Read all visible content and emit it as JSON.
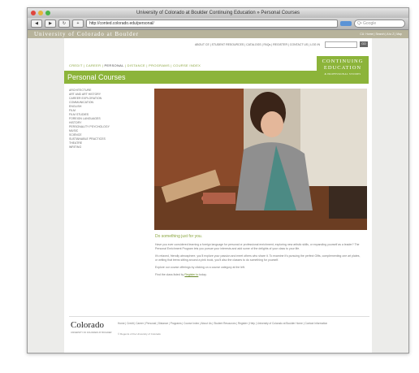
{
  "window": {
    "title": "University of Colorado at Boulder Continuing Education » Personal Courses"
  },
  "toolbar": {
    "back": "◀",
    "forward": "▶",
    "refresh": "↻",
    "add": "+",
    "url": "http://conted.colorado.edu/personal/",
    "search_placeholder": "Q• Google"
  },
  "cu_header": {
    "brand": "University of Colorado at Boulder",
    "links": "CU: Home | Search | A to Z | Map"
  },
  "top_nav": "ABOUT CE | STUDENT RESOURCES | CATALOGS | FAQs | REGISTER | CONTACT US | LOG IN",
  "site_search": {
    "button": "GO"
  },
  "section_nav": {
    "items": [
      "CREDIT",
      "CAREER",
      "PERSONAL",
      "DISTANCE",
      "PROGRAMS",
      "COURSE INDEX"
    ],
    "active": "PERSONAL"
  },
  "logo": {
    "line1": "CONTINUING",
    "line2": "EDUCATION",
    "line3": "& PROFESSIONAL STUDIES"
  },
  "page_title": "Personal Courses",
  "sidebar": {
    "items": [
      "ARCHITECTURE",
      "ART AND ART HISTORY",
      "CAREER EXPLORATION",
      "COMMUNICATION",
      "ENGLISH",
      "FILM",
      "FILM STUDIES",
      "FOREIGN LANGUAGES",
      "HISTORY",
      "PERSONALITY PSYCHOLOGY",
      "MUSIC",
      "SCIENCE",
      "SUSTAINABLE PRACTICES",
      "THEATRE",
      "WRITING"
    ]
  },
  "content": {
    "tagline": "Do something just for you.",
    "p1": "Have you ever considered learning a foreign language for personal or professional enrichment, exploring new artistic skills, or expanding yourself as a leader? The Personal Enrichment Program lets you pursue your interests and add some of the delights of your class to your life.",
    "p2": "It's relaxed, friendly atmosphere, you'll explore your passion and meet others who share it. To examine it's pursuing the perfect Gifts, complementing one art plates, or writing that teens sitting around a pink book, you'll also the classes to do something for yourself.",
    "p3": "Explore our course offerings by clicking on a course category at the left.",
    "p4_prefix": "Find the class listed by ",
    "p4_link": "Register to",
    "p4_suffix": " today."
  },
  "footer": {
    "wordmark": "Colorado",
    "sub": "UNIVERSITY OF COLORADO AT BOULDER",
    "links": "Home | Credit | Career | Personal | Distance | Programs | Course Index | About Us | Student Resources | Register | Help | University of Colorado at Boulder Home | Contact Information",
    "copyright": "© Regents of the University of Colorado"
  },
  "colors": {
    "accent": "#8cb43a",
    "header": "#b7b39b"
  }
}
